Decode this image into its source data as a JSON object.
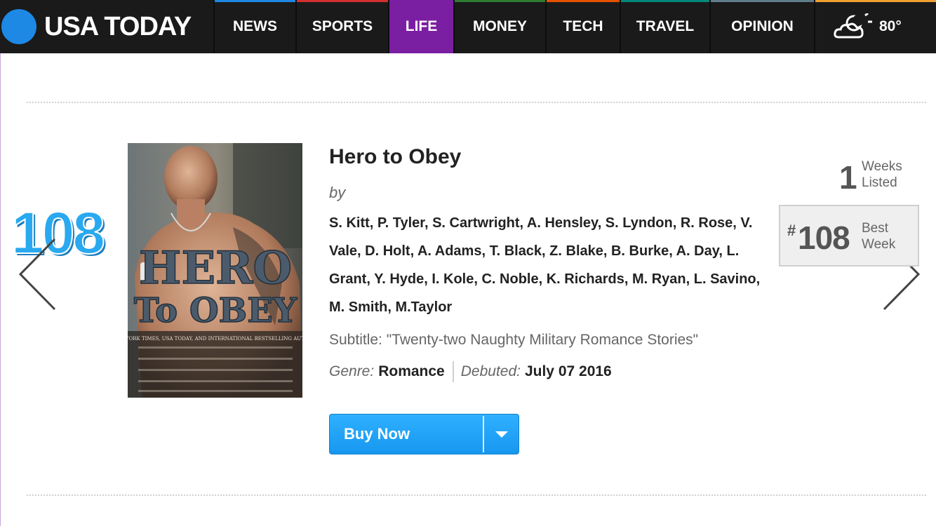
{
  "header": {
    "logo": "USA TODAY",
    "nav": [
      {
        "label": "NEWS",
        "color": "#1e88e5"
      },
      {
        "label": "SPORTS",
        "color": "#d32f2f"
      },
      {
        "label": "LIFE",
        "color": "#7b1fa2"
      },
      {
        "label": "MONEY",
        "color": "#2e7d32"
      },
      {
        "label": "TECH",
        "color": "#e65100"
      },
      {
        "label": "TRAVEL",
        "color": "#00897b"
      },
      {
        "label": "OPINION",
        "color": "#607d8b"
      }
    ],
    "active_tab": "LIFE",
    "weather": {
      "icon": "partly-cloudy-night-icon",
      "temperature": "80°"
    }
  },
  "book": {
    "rank": "108",
    "title": "Hero to Obey",
    "by_label": "by",
    "authors": "S. Kitt, P. Tyler, S. Cartwright, A. Hensley, S. Lyndon, R. Rose, V. Vale, D. Holt, A. Adams, T. Black, Z. Blake, B. Burke, A. Day, L. Grant, Y. Hyde, I. Kole, C. Noble, K. Richards, M. Ryan, L. Savino, M. Smith, M.Taylor",
    "subtitle_label": "Subtitle:",
    "subtitle": "\"Twenty-two Naughty Military Romance Stories\"",
    "genre_label": "Genre:",
    "genre": "Romance",
    "debuted_label": "Debuted:",
    "debuted": "July 07 2016",
    "cover": {
      "title_line1": "HERO",
      "title_line2": "To OBEY",
      "tagline": "NEW YORK TIMES, USA TODAY, AND INTERNATIONAL BESTSELLING AUTHORS"
    }
  },
  "buy": {
    "label": "Buy Now"
  },
  "stats": {
    "weeks_listed": "1",
    "weeks_line1": "Weeks",
    "weeks_line2": "Listed",
    "best_hash": "#",
    "best_rank": "108",
    "best_line1": "Best",
    "best_line2": "Week"
  },
  "colors": {
    "accent": "#29a9ef",
    "buy": "#1e9bf0",
    "life_tab": "#7b1fa2"
  }
}
